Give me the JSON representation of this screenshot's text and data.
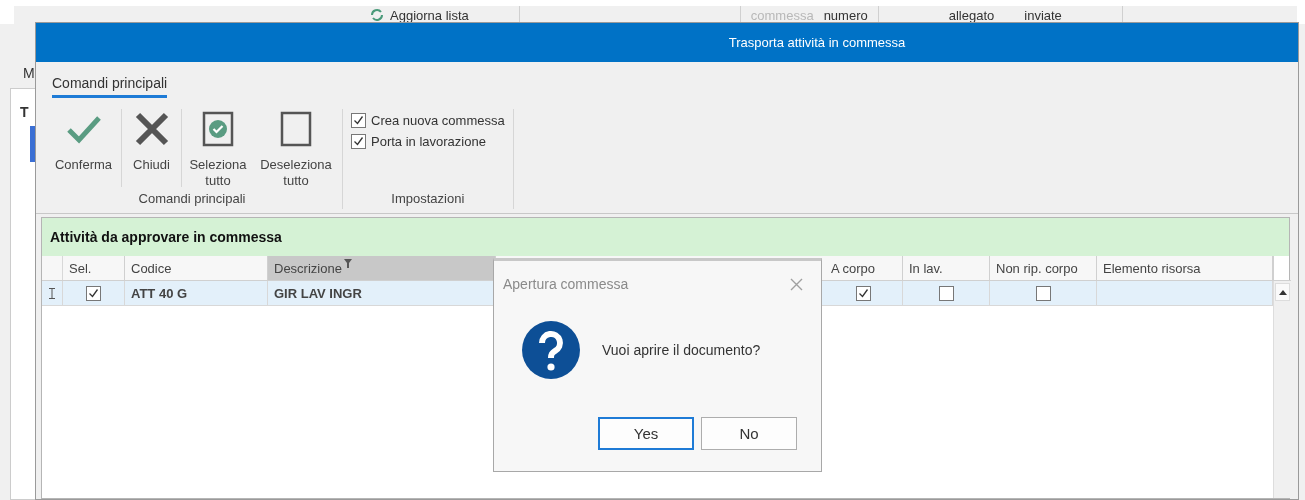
{
  "background_app": {
    "refresh_button": "Aggiorna lista",
    "side_letters": [
      {
        "label": "M",
        "bold": false
      },
      {
        "label": "T",
        "bold": true
      }
    ],
    "column_headers": [
      {
        "label": "commessa",
        "disabled": true
      },
      {
        "label": "numero",
        "disabled": false
      },
      {
        "label": "allegato",
        "disabled": false
      },
      {
        "label": "inviate",
        "disabled": false
      }
    ]
  },
  "window": {
    "title": "Trasporta attività in commessa"
  },
  "ribbon": {
    "tabs": [
      {
        "label": "Comandi principali",
        "selected": true
      }
    ],
    "groups": [
      {
        "label": "Comandi principali",
        "items": [
          {
            "kind": "button",
            "label": "Conferma"
          },
          {
            "kind": "button",
            "label": "Chiudi"
          },
          {
            "kind": "button",
            "label": "Seleziona tutto"
          },
          {
            "kind": "button",
            "label": "Deseleziona tutto"
          }
        ]
      },
      {
        "label": "Impostazioni",
        "items": [
          {
            "kind": "checkbox",
            "label": "Crea nuova commessa",
            "checked": true
          },
          {
            "kind": "checkbox",
            "label": "Porta in lavorazione",
            "checked": true
          }
        ]
      }
    ]
  },
  "grid": {
    "title": "Attività da approvare in commessa",
    "columns": [
      {
        "label": "Sel.",
        "kind": "check",
        "filtered": false
      },
      {
        "label": "Codice",
        "kind": "text",
        "filtered": false
      },
      {
        "label": "Descrizione",
        "kind": "text",
        "filtered": true
      },
      {
        "label": "A corpo",
        "kind": "check",
        "filtered": false
      },
      {
        "label": "In lav.",
        "kind": "check",
        "filtered": false
      },
      {
        "label": "Non rip. corpo",
        "kind": "check",
        "filtered": false
      },
      {
        "label": "Elemento risorsa",
        "kind": "text",
        "filtered": false
      }
    ],
    "rows": [
      {
        "selected": true,
        "cells": [
          true,
          "ATT 40 G",
          "GIR LAV INGR",
          true,
          false,
          false,
          null
        ]
      }
    ]
  },
  "message_box": {
    "title": "Apertura commessa",
    "message": "Vuoi aprire il documento?",
    "buttons": [
      {
        "label": "Yes",
        "focused": true
      },
      {
        "label": "No",
        "focused": false
      }
    ]
  }
}
